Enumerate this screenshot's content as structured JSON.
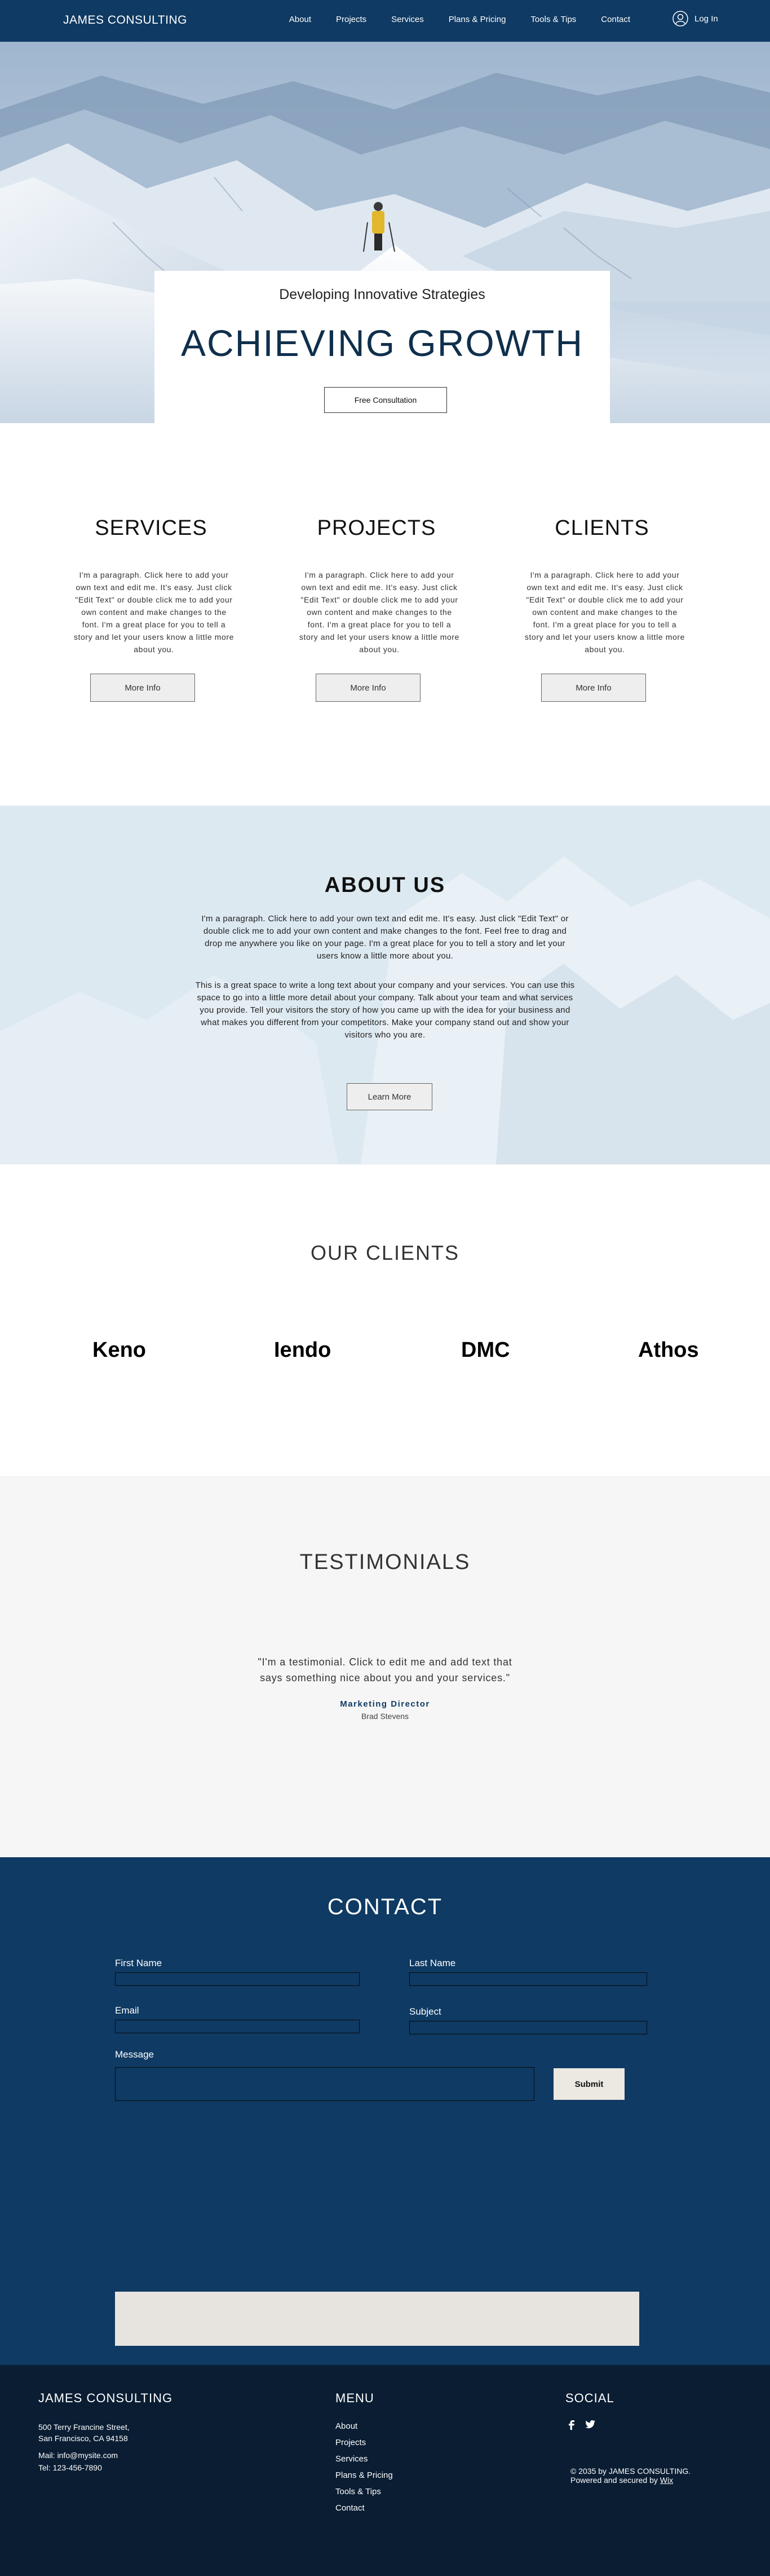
{
  "header": {
    "logo": "JAMES CONSULTING",
    "nav": [
      {
        "label": "About"
      },
      {
        "label": "Projects"
      },
      {
        "label": "Services"
      },
      {
        "label": "Plans & Pricing"
      },
      {
        "label": "Tools & Tips"
      },
      {
        "label": "Contact"
      }
    ],
    "login_label": "Log In"
  },
  "hero": {
    "subtitle": "Developing Innovative Strategies",
    "title": "ACHIEVING GROWTH",
    "button": "Free Consultation"
  },
  "columns": [
    {
      "title": "SERVICES",
      "text": "I'm a paragraph. Click here to add your own text and edit me. It's easy. Just click \"Edit Text\" or double click me to add your own content and make changes to the font. I'm a great place for you to tell a story and let your users know a little more about you.",
      "button": "More Info"
    },
    {
      "title": "PROJECTS",
      "text": "I'm a paragraph. Click here to add your own text and edit me. It's easy. Just click \"Edit Text\" or double click me to add your own content and make changes to the font. I'm a great place for you to tell a story and let your users know a little more about you.",
      "button": "More Info"
    },
    {
      "title": "CLIENTS",
      "text": "I'm a paragraph. Click here to add your own text and edit me. It's easy. Just click \"Edit Text\" or double click me to add your own content and make changes to the font. I'm a great place for you to tell a story and let your users know a little more about you.",
      "button": "More Info"
    }
  ],
  "about": {
    "title": "ABOUT US",
    "p1": "I'm a paragraph. Click here to add your own text and edit me. It's easy. Just click \"Edit Text\" or double click me to add your own content and make changes to the font. Feel free to drag and drop me anywhere you like on your page. I'm a great place for you to tell a story and let your users know a little more about you.",
    "p2": "This is a great space to write a long text about your company and your services. You can use this space to go into a little more detail about your company. Talk about your team and what services you provide. Tell your visitors the story of how you came up with the idea for your business and what makes you different from your competitors. Make your company stand out and show your visitors who you are.",
    "button": "Learn More"
  },
  "clients": {
    "title": "OUR CLIENTS",
    "logos": [
      "Keno",
      "Iendo",
      "DMC",
      "Athos"
    ]
  },
  "testimonials": {
    "title": "TESTIMONIALS",
    "quote": "\"I'm a testimonial. Click to edit me and add text that says something nice about you and your services.\"",
    "role": "Marketing Director",
    "name": "Brad Stevens"
  },
  "contact": {
    "title": "CONTACT",
    "first_name_label": "First Name",
    "last_name_label": "Last Name",
    "email_label": "Email",
    "subject_label": "Subject",
    "message_label": "Message",
    "submit_label": "Submit"
  },
  "footer": {
    "company": "JAMES CONSULTING",
    "address1": "500 Terry Francine Street,",
    "address2": "San Francisco, CA 94158",
    "mail": "Mail:  info@mysite.com",
    "tel": "Tel:  123-456-7890",
    "menu_title": "MENU",
    "menu": [
      "About",
      "Projects",
      "Services",
      "Plans & Pricing",
      "Tools & Tips",
      "Contact"
    ],
    "social_title": "SOCIAL",
    "copyright1": "© 2035 by JAMES CONSULTING.",
    "copyright2_prefix": "Powered and secured by ",
    "copyright2_link": "Wix"
  },
  "colors": {
    "header_bg": "#0f3a63",
    "contact_bg": "#0e3a63",
    "footer_bg": "#0a1d33",
    "about_bg": "#dde9f1",
    "testimonials_bg": "#f6f6f6"
  }
}
